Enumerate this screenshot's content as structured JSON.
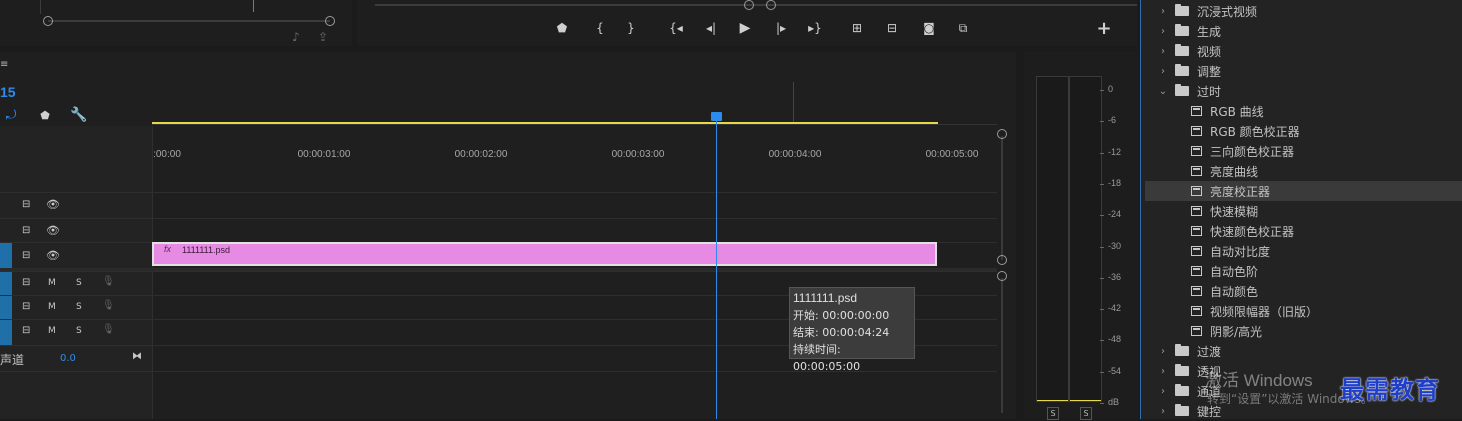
{
  "timeline": {
    "timecode_fragment": "15",
    "menu_glyph": "≡",
    "ruler_ticks": [
      ":00:00",
      "00:00:01:00",
      "00:00:02:00",
      "00:00:03:00",
      "00:00:04:00",
      "00:00:05:00"
    ],
    "video_tracks": [
      {
        "eye": "👁"
      },
      {
        "eye": "👁"
      },
      {
        "eye": "👁"
      }
    ],
    "audio_tracks": [
      {
        "m": "M",
        "s": "S"
      },
      {
        "m": "M",
        "s": "S"
      },
      {
        "m": "M",
        "s": "S"
      }
    ],
    "master_label": "声道",
    "master_value": "0.0",
    "clip_name": "1111111.psd",
    "clip_fx": "fx"
  },
  "tooltip": {
    "name": "1111111.psd",
    "start": "开始: 00:00:00:00",
    "end": "结束: 00:00:04:24",
    "duration": "持续时间: 00:00:05:00"
  },
  "meter": {
    "db_labels": [
      "0",
      "-6",
      "-12",
      "-18",
      "-24",
      "-30",
      "-36",
      "-42",
      "-48",
      "-54",
      "dB"
    ],
    "solo_left": "S",
    "solo_right": "S"
  },
  "effects_panel": {
    "folders_top": [
      "沉浸式视频",
      "生成",
      "视频",
      "调整"
    ],
    "open_folder": "过时",
    "items": [
      "RGB 曲线",
      "RGB 颜色校正器",
      "三向颜色校正器",
      "亮度曲线",
      "亮度校正器",
      "快速模糊",
      "快速颜色校正器",
      "自动对比度",
      "自动色阶",
      "自动颜色",
      "视频限幅器（旧版）",
      "阴影/高光"
    ],
    "selected_index": 4,
    "folders_bottom": [
      "过渡",
      "透视",
      "通道",
      "键控"
    ]
  },
  "watermark": {
    "activate_line1": "激活 Windows",
    "activate_line2": "转到“设置”以激活 Windows。",
    "brand": "最需教育"
  },
  "colors": {
    "playhead": "#2d8ceb",
    "clip": "#e68ae3",
    "work_area": "#e6d84a",
    "selected_row": "#3a3a3a"
  }
}
